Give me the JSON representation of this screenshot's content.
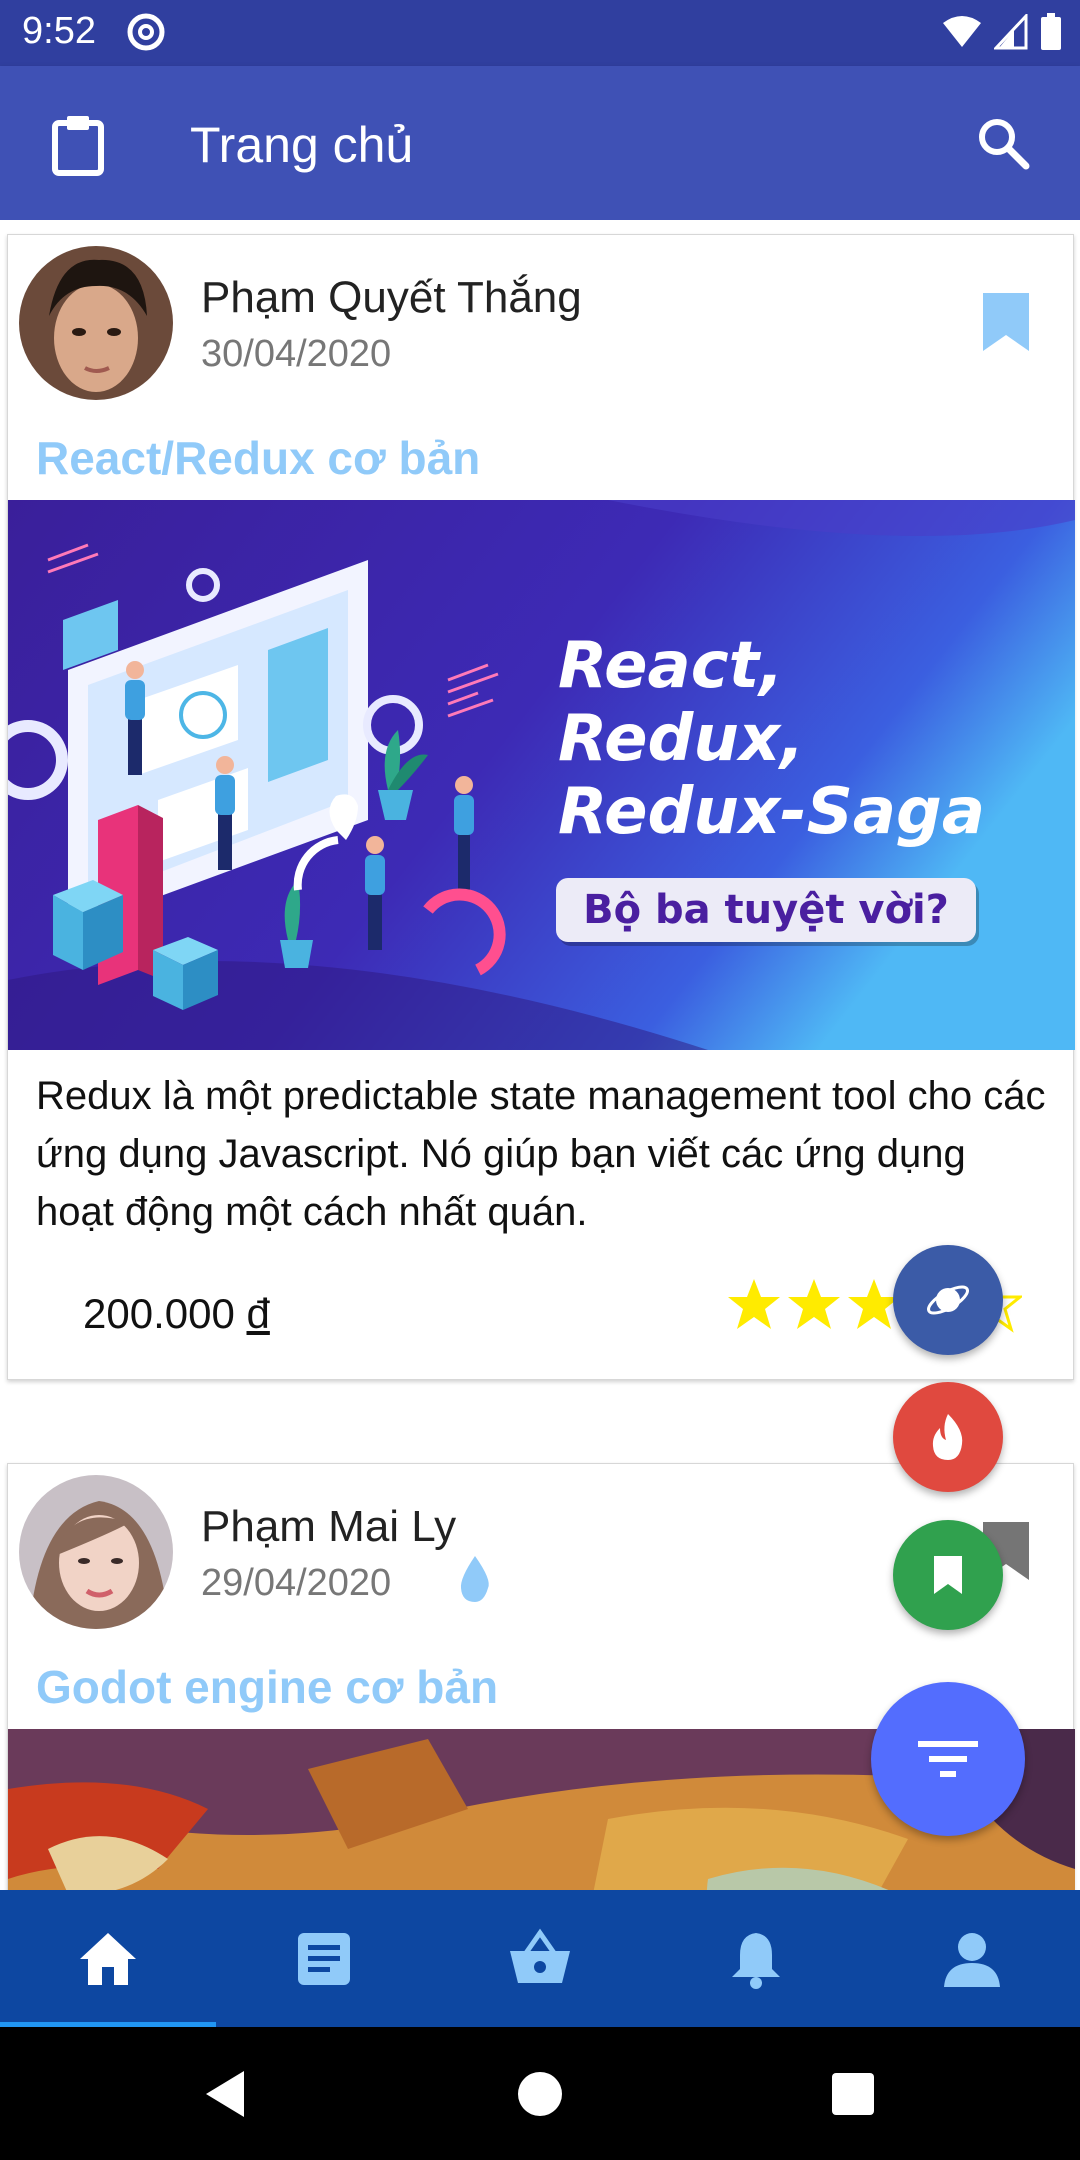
{
  "status_bar": {
    "time": "9:52"
  },
  "app_bar": {
    "title": "Trang chủ"
  },
  "posts": [
    {
      "author": "Phạm Quyết Thắng",
      "date": "30/04/2020",
      "title": "React/Redux cơ bản",
      "banner": {
        "lines": [
          "React,",
          "Redux,",
          "Redux-Saga"
        ],
        "tagline": "Bộ ba tuyệt vời?"
      },
      "description": "Redux là một predictable state management tool cho các ứng dụng Javascript. Nó giúp bạn viết các ứng dụng hoạt động một cách nhất quán.",
      "price": "200.000",
      "currency": "đ",
      "rating": 4
    },
    {
      "author": "Phạm Mai Ly",
      "date": "29/04/2020",
      "title": "Godot engine cơ bản"
    }
  ],
  "fabs": [
    "planet-icon",
    "fire-icon",
    "bookmark-icon",
    "filter-icon"
  ],
  "bottom_nav": [
    "home-icon",
    "article-icon",
    "basket-icon",
    "bell-icon",
    "person-icon"
  ],
  "colors": {
    "status_bar": "#303f9f",
    "app_bar": "#3f51b5",
    "course_title": "#90caf9",
    "bottom_nav": "#0d47a1",
    "star": "#ffeb00",
    "fab_filter": "#536dfe"
  }
}
